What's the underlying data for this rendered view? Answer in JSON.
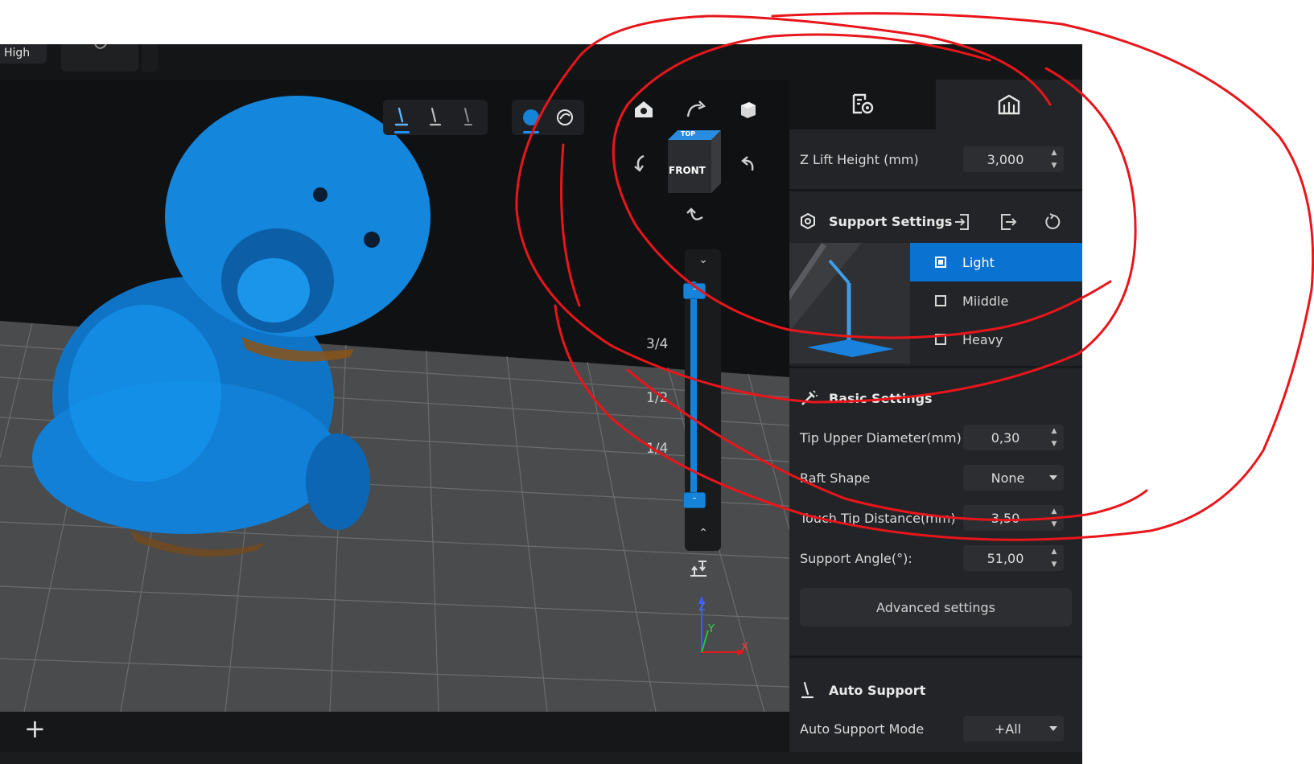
{
  "topbar": {
    "quality_label": "High"
  },
  "viewport": {
    "view_cube": {
      "top_label": "TOP",
      "front_label": "FRONT"
    },
    "layer_slider": {
      "marks": [
        "3/4",
        "1/2",
        "1/4"
      ]
    },
    "axis_labels": {
      "x": "X",
      "y": "Y",
      "z": "Z"
    },
    "support_tools": [
      "support-tool-1",
      "support-tool-2",
      "support-tool-3"
    ],
    "view_tools": [
      "solid-view",
      "xray-view"
    ],
    "add_label": "+"
  },
  "right_panel": {
    "tabs": [
      "tab-print-settings",
      "tab-supports"
    ],
    "z_lift": {
      "label": "Z Lift Height (mm)",
      "value": "3,000"
    },
    "support_settings": {
      "title": "Support Settings",
      "presets": [
        {
          "label": "Light",
          "selected": true
        },
        {
          "label": "Miiddle",
          "selected": false
        },
        {
          "label": "Heavy",
          "selected": false
        }
      ]
    },
    "basic_settings": {
      "title": "Basic Settings",
      "tip_upper_diameter": {
        "label": "Tip Upper Diameter(mm)",
        "value": "0,30"
      },
      "raft_shape": {
        "label": "Raft Shape",
        "value": "None"
      },
      "touch_tip_distance": {
        "label": "Touch Tip Distance(mm)",
        "value": "3,50"
      },
      "support_angle": {
        "label": "Support Angle(°):",
        "value": "51,00"
      },
      "advanced_button": "Advanced settings"
    },
    "auto_support": {
      "title": "Auto Support",
      "mode": {
        "label": "Auto Support Mode",
        "value": "+All"
      }
    }
  },
  "colors": {
    "accent": "#0a72d1",
    "model": "#1583d8",
    "annotation": "#e8161b",
    "panel": "#232427",
    "viewport": "#101113"
  }
}
